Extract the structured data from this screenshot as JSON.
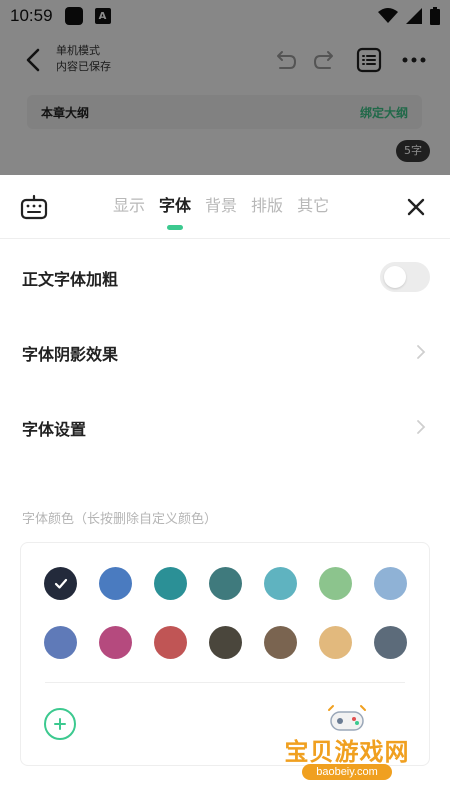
{
  "status_bar": {
    "time": "10:59",
    "badge_letter": "A"
  },
  "editor": {
    "mode_title": "单机模式",
    "save_status": "内容已保存",
    "outline_title": "本章大纲",
    "outline_bind": "绑定大纲",
    "word_count": "5字"
  },
  "sheet": {
    "tabs": [
      {
        "label": "显示",
        "active": false
      },
      {
        "label": "字体",
        "active": true
      },
      {
        "label": "背景",
        "active": false
      },
      {
        "label": "排版",
        "active": false
      },
      {
        "label": "其它",
        "active": false
      }
    ],
    "rows": {
      "bold_body": "正文字体加粗",
      "shadow": "字体阴影效果",
      "font_settings": "字体设置"
    },
    "bold_toggle_on": false,
    "color_section_label": "字体颜色（长按删除自定义颜色）",
    "colors": [
      "#232a3b",
      "#4a7bc0",
      "#2b9096",
      "#3f7a7d",
      "#5fb3c0",
      "#8cc48d",
      "#8fb2d6",
      "#5f7ab8",
      "#b54a7e",
      "#c05555",
      "#4a463c",
      "#7a6450",
      "#e2b97d",
      "#5c6b7a"
    ],
    "selected_color_index": 0,
    "accent_color": "#3cc98f"
  },
  "watermark": {
    "text": "宝贝游戏网",
    "url": "baobeiy.com"
  }
}
